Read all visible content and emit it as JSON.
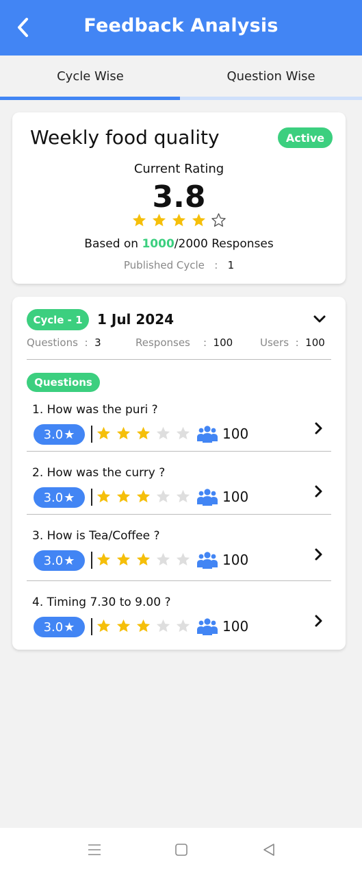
{
  "header": {
    "title": "Feedback Analysis",
    "back_icon": "back-chevron-icon"
  },
  "tabs": [
    {
      "label": "Cycle Wise",
      "active": true
    },
    {
      "label": "Question Wise",
      "active": false
    }
  ],
  "summary": {
    "title": "Weekly food quality",
    "status": "Active",
    "current_rating_label": "Current Rating",
    "current_rating": "3.8",
    "stars": 4,
    "based_on_prefix": "Based on ",
    "responses_received": "1000",
    "responses_suffix": "/2000 Responses",
    "published_label": "Published Cycle",
    "published_sep": ":",
    "published_value": "1"
  },
  "cycle": {
    "badge": "Cycle - 1",
    "date": "1 Jul 2024",
    "questions_label": "Questions",
    "questions_value": "3",
    "responses_label": "Responses",
    "responses_value": "100",
    "users_label": "Users",
    "users_value": "100",
    "sep": ":",
    "questions_badge": "Questions",
    "items": [
      {
        "text": "1. How was the puri ?",
        "rating": "3.0",
        "stars": 3,
        "count": "100"
      },
      {
        "text": "2. How was the curry ?",
        "rating": "3.0",
        "stars": 3,
        "count": "100"
      },
      {
        "text": "3. How is Tea/Coffee ?",
        "rating": "3.0",
        "stars": 3,
        "count": "100"
      },
      {
        "text": "4. Timing 7.30 to 9.00 ?",
        "rating": "3.0",
        "stars": 3,
        "count": "100"
      }
    ]
  },
  "colors": {
    "primary": "#4285f4",
    "green": "#3ccf7f",
    "star_filled": "#f5bf0a",
    "star_empty": "#dedede"
  },
  "navbar": {
    "icons": [
      "menu-icon",
      "home-square-icon",
      "back-triangle-icon"
    ]
  }
}
